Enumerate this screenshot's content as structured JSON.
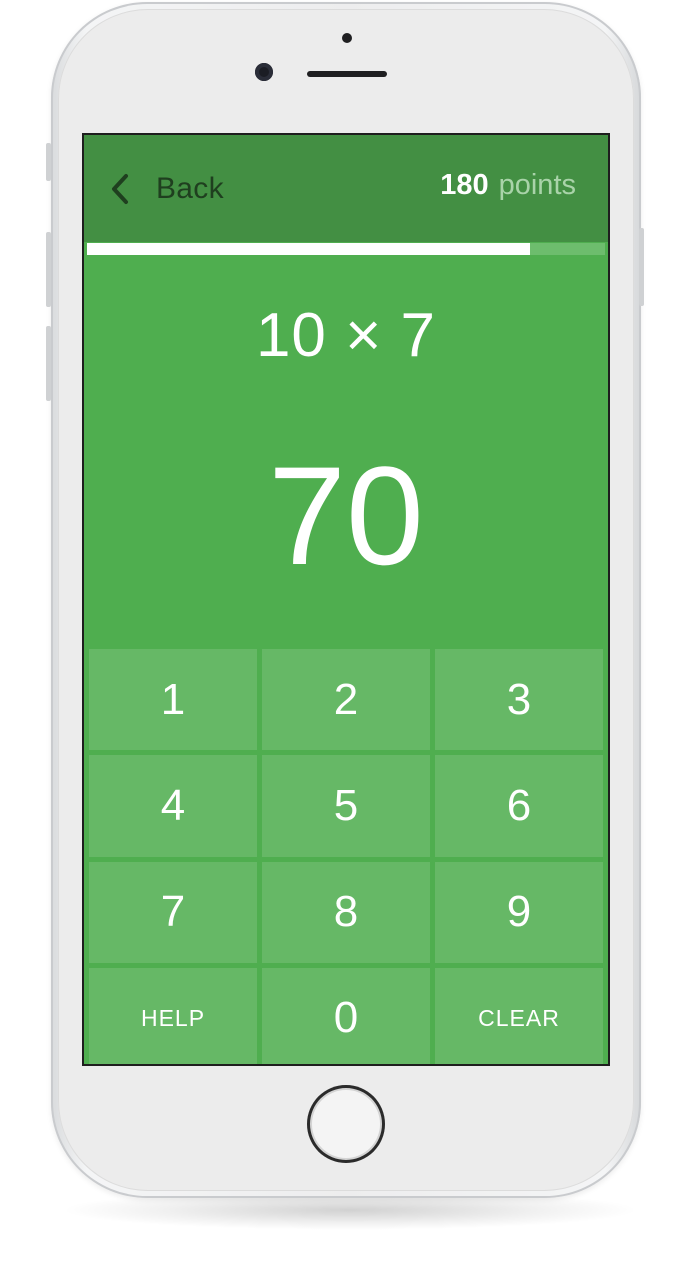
{
  "app": {
    "accent_color": "#4fae4f",
    "header_color": "#438f43"
  },
  "header": {
    "back_label": "Back",
    "back_icon": "chevron-left-icon",
    "points_value": "180",
    "points_label": "points"
  },
  "progress": {
    "fraction": 0.855
  },
  "problem": {
    "question": "10 × 7",
    "answer": "70"
  },
  "keypad": {
    "keys": [
      {
        "label": "1"
      },
      {
        "label": "2"
      },
      {
        "label": "3"
      },
      {
        "label": "4"
      },
      {
        "label": "5"
      },
      {
        "label": "6"
      },
      {
        "label": "7"
      },
      {
        "label": "8"
      },
      {
        "label": "9"
      },
      {
        "label": "HELP"
      },
      {
        "label": "0"
      },
      {
        "label": "CLEAR"
      }
    ]
  }
}
